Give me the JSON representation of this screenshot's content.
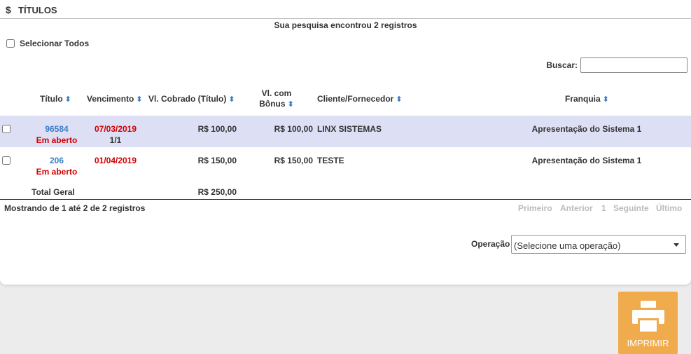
{
  "header": {
    "icon": "dollar-icon",
    "icon_glyph": "$",
    "title": "TÍTULOS"
  },
  "found_text": "Sua pesquisa encontrou 2 registros",
  "select_all_label": "Selecionar Todos",
  "search": {
    "label": "Buscar:",
    "value": "",
    "placeholder": ""
  },
  "columns": {
    "titulo": "Título",
    "vencimento": "Vencimento",
    "vl_cobrado": "Vl. Cobrado (Título)",
    "vl_bonus_line1": "Vl. com",
    "vl_bonus_line2": "Bônus",
    "cliente": "Cliente/Fornecedor",
    "franquia": "Franquia",
    "sort_glyph": "⬍"
  },
  "rows": [
    {
      "titulo": "96584",
      "status": "Em aberto",
      "vencimento": "07/03/2019",
      "parcela": "1/1",
      "vl_cobrado": "R$ 100,00",
      "vl_bonus": "R$ 100,00",
      "cliente": "LINX SISTEMAS",
      "franquia": "Apresentação do Sistema 1"
    },
    {
      "titulo": "206",
      "status": "Em aberto",
      "vencimento": "01/04/2019",
      "parcela": "",
      "vl_cobrado": "R$ 150,00",
      "vl_bonus": "R$ 150,00",
      "cliente": "TESTE",
      "franquia": "Apresentação do Sistema 1"
    }
  ],
  "total": {
    "label": "Total Geral",
    "value": "R$ 250,00"
  },
  "showing_text": "Mostrando de 1 até 2 de 2 registros",
  "pager": {
    "first": "Primeiro",
    "prev": "Anterior",
    "page": "1",
    "next": "Seguinte",
    "last": "Último"
  },
  "operation": {
    "label": "Operação",
    "selected": "(Selecione uma operação)"
  },
  "print_button": {
    "label": "IMPRIMIR",
    "icon": "printer-icon"
  },
  "colors": {
    "accent": "#3b7dc4",
    "danger": "#d40000",
    "row_highlight": "#dddff5",
    "print_button": "#f0ab4c"
  }
}
